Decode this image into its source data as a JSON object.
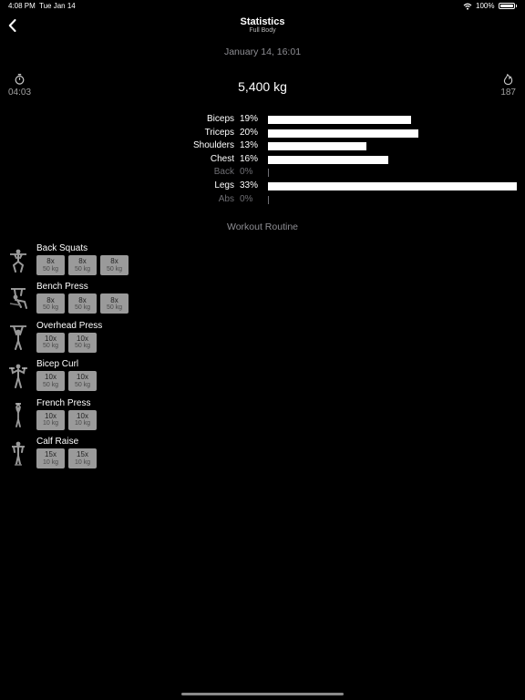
{
  "status_bar": {
    "time": "4:08 PM",
    "date": "Tue Jan 14",
    "battery": "100%"
  },
  "nav": {
    "title": "Statistics",
    "subtitle": "Full Body"
  },
  "session": {
    "date": "January 14, 16:01",
    "duration": "04:03",
    "total_weight": "5,400 kg",
    "calories": "187"
  },
  "muscles": [
    {
      "name": "Biceps",
      "percent_label": "19%",
      "percent": 19
    },
    {
      "name": "Triceps",
      "percent_label": "20%",
      "percent": 20
    },
    {
      "name": "Shoulders",
      "percent_label": "13%",
      "percent": 13
    },
    {
      "name": "Chest",
      "percent_label": "16%",
      "percent": 16
    },
    {
      "name": "Back",
      "percent_label": "0%",
      "percent": 0
    },
    {
      "name": "Legs",
      "percent_label": "33%",
      "percent": 33
    },
    {
      "name": "Abs",
      "percent_label": "0%",
      "percent": 0
    }
  ],
  "routine_title": "Workout Routine",
  "exercises": [
    {
      "name": "Back Squats",
      "icon": "squat-figure-icon",
      "sets": [
        {
          "reps": "8x",
          "weight": "50 kg"
        },
        {
          "reps": "8x",
          "weight": "50 kg"
        },
        {
          "reps": "8x",
          "weight": "50 kg"
        }
      ]
    },
    {
      "name": "Bench Press",
      "icon": "bench-press-figure-icon",
      "sets": [
        {
          "reps": "8x",
          "weight": "50 kg"
        },
        {
          "reps": "8x",
          "weight": "50 kg"
        },
        {
          "reps": "8x",
          "weight": "50 kg"
        }
      ]
    },
    {
      "name": "Overhead Press",
      "icon": "overhead-press-figure-icon",
      "sets": [
        {
          "reps": "10x",
          "weight": "50 kg"
        },
        {
          "reps": "10x",
          "weight": "50 kg"
        }
      ]
    },
    {
      "name": "Bicep Curl",
      "icon": "bicep-curl-figure-icon",
      "sets": [
        {
          "reps": "10x",
          "weight": "50 kg"
        },
        {
          "reps": "10x",
          "weight": "50 kg"
        }
      ]
    },
    {
      "name": "French Press",
      "icon": "french-press-figure-icon",
      "sets": [
        {
          "reps": "10x",
          "weight": "10 kg"
        },
        {
          "reps": "10x",
          "weight": "10 kg"
        }
      ]
    },
    {
      "name": "Calf Raise",
      "icon": "calf-raise-figure-icon",
      "sets": [
        {
          "reps": "15x",
          "weight": "10 kg"
        },
        {
          "reps": "15x",
          "weight": "10 kg"
        }
      ]
    }
  ]
}
